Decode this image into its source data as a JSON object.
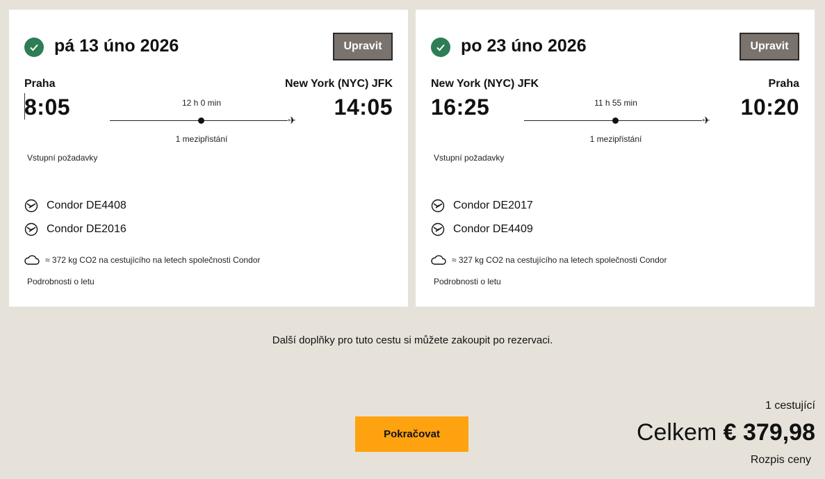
{
  "outbound": {
    "date": "pá 13 úno 2026",
    "edit_label": "Upravit",
    "origin_city": "Praha",
    "destination_city": "New York (NYC) JFK",
    "departure_time": "8:05",
    "arrival_time": "14:05",
    "duration": "12 h 0 min",
    "stops": "1 mezipřistání",
    "requirements_label": "Vstupní požadavky",
    "flights": [
      "Condor DE4408",
      "Condor DE2016"
    ],
    "co2": "≈ 372 kg CO2 na cestujícího na letech společnosti Condor",
    "details_label": "Podrobnosti o letu"
  },
  "inbound": {
    "date": "po 23 úno 2026",
    "edit_label": "Upravit",
    "origin_city": "New York (NYC) JFK",
    "destination_city": "Praha",
    "departure_time": "16:25",
    "arrival_time": "10:20",
    "duration": "11 h 55 min",
    "stops": "1 mezipřistání",
    "requirements_label": "Vstupní požadavky",
    "flights": [
      "Condor DE2017",
      "Condor DE4409"
    ],
    "co2": "≈ 327 kg CO2 na cestujícího na letech společnosti Condor",
    "details_label": "Podrobnosti o letu"
  },
  "addons_note": "Další doplňky pro tuto cestu si můžete zakoupit po rezervaci.",
  "continue_label": "Pokračovat",
  "summary": {
    "passengers": "1 cestující",
    "total_label": "Celkem",
    "total_amount": "€ 379,98",
    "breakdown_label": "Rozpis ceny"
  },
  "colors": {
    "background": "#e6e2da",
    "check": "#2e7d55",
    "edit_button": "#7a726c",
    "continue_button": "#ffa20f"
  },
  "icons": {
    "confirmed": "check-circle-icon",
    "airline": "condor-logo-icon",
    "co2": "cloud-icon",
    "destination": "airplane-icon"
  }
}
